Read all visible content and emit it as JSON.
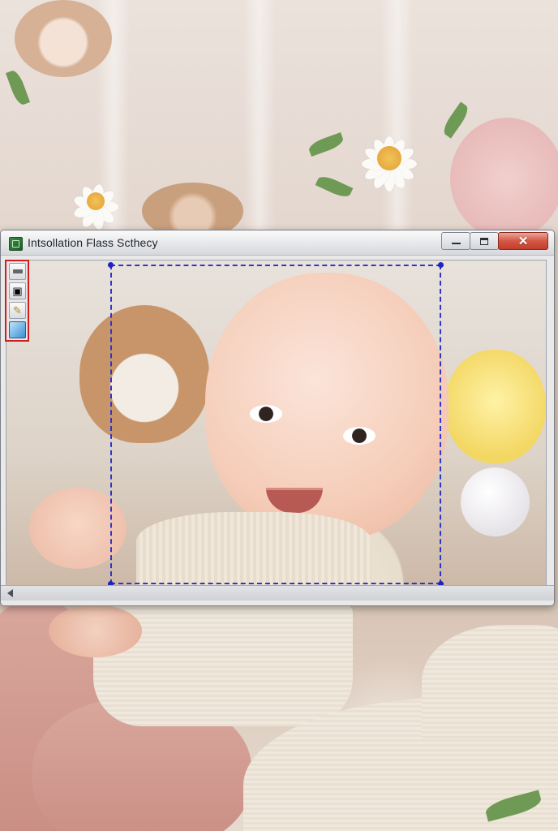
{
  "window": {
    "title": "Intsollation Flass Scthecy",
    "close_glyph": "✕"
  },
  "icons": {
    "app": "app-icon",
    "tools": [
      "line-tool-icon",
      "camera-tool-icon",
      "brush-tool-icon",
      "image-tool-icon"
    ],
    "mini": "image-colors-icon"
  },
  "colors": {
    "selection": "#2e35c9",
    "toolbox_border": "#d11d1d",
    "close_button": "#d55744"
  }
}
